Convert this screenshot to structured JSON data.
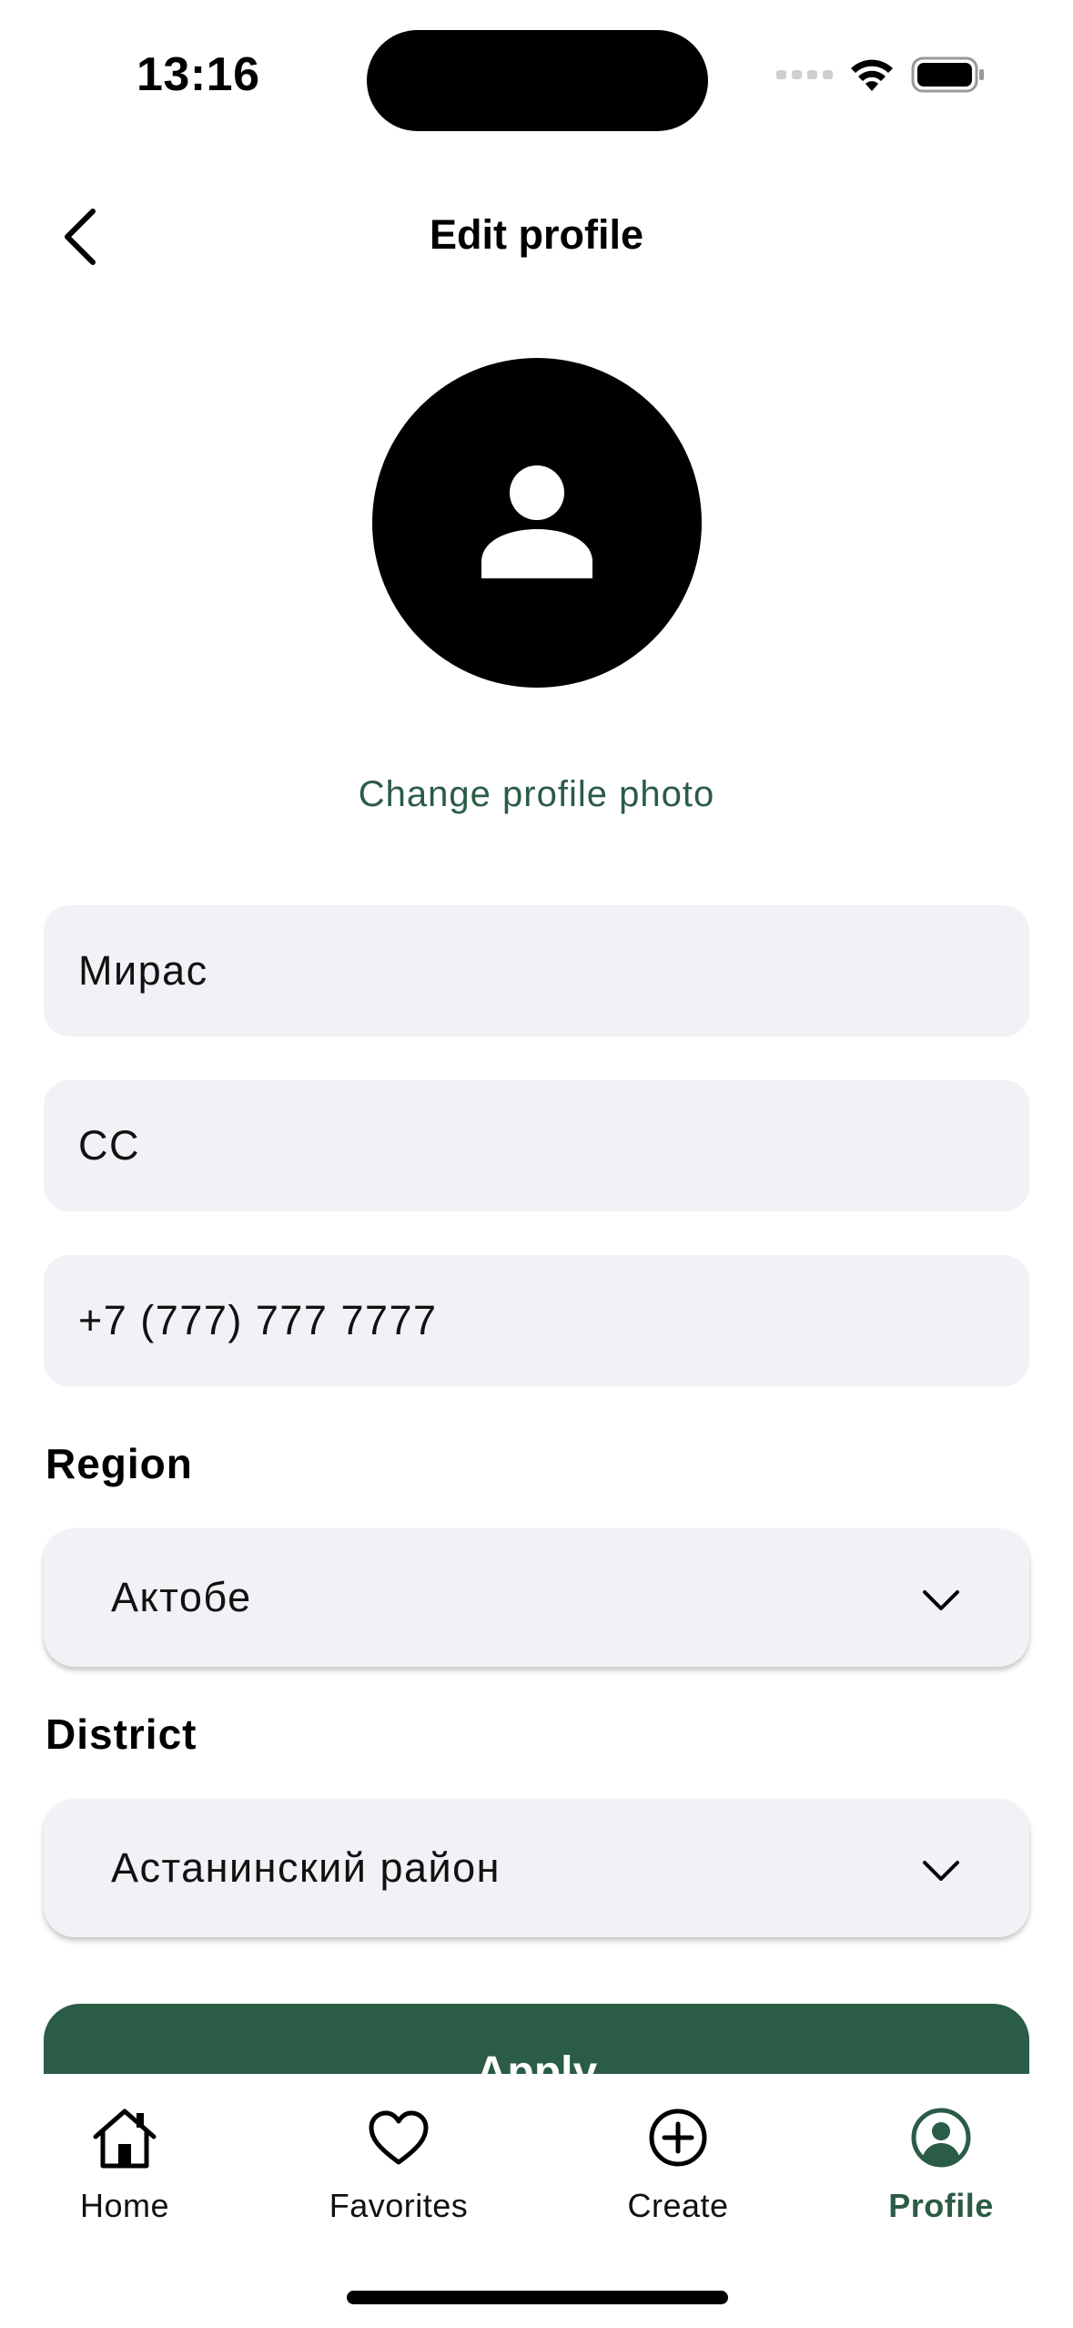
{
  "status_bar": {
    "time": "13:16"
  },
  "header": {
    "title": "Edit profile"
  },
  "profile": {
    "change_photo_label": "Change profile photo"
  },
  "form": {
    "first_name": "Мирас",
    "last_name": "СС",
    "phone": "+7 (777) 777 7777",
    "region_label": "Region",
    "region_value": "Актобе",
    "district_label": "District",
    "district_value": "Астанинский район",
    "apply_label": "Apply"
  },
  "tab_bar": {
    "home": "Home",
    "favorites": "Favorites",
    "create": "Create",
    "profile": "Profile"
  },
  "colors": {
    "accent": "#2b5c45",
    "field_bg": "#f1f1f6"
  }
}
